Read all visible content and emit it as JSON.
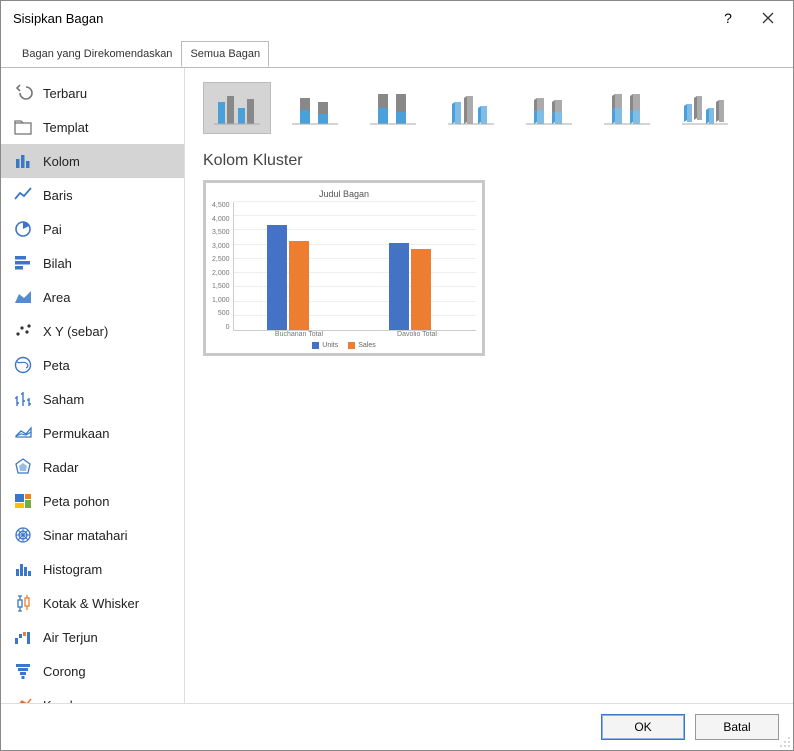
{
  "title": "Sisipkan Bagan",
  "tabs": [
    {
      "label": "Bagan yang Direkomendaskan",
      "active": false
    },
    {
      "label": "Semua Bagan",
      "active": true
    }
  ],
  "sidebar": [
    {
      "icon": "undo",
      "label": "Terbaru"
    },
    {
      "icon": "folder",
      "label": "Templat"
    },
    {
      "icon": "column",
      "label": "Kolom",
      "active": true
    },
    {
      "icon": "line",
      "label": "Baris"
    },
    {
      "icon": "pie",
      "label": "Pai"
    },
    {
      "icon": "bar",
      "label": "Bilah"
    },
    {
      "icon": "area",
      "label": "Area"
    },
    {
      "icon": "scatter",
      "label": "X Y (sebar)"
    },
    {
      "icon": "map",
      "label": "Peta"
    },
    {
      "icon": "stock",
      "label": "Saham"
    },
    {
      "icon": "surface",
      "label": "Permukaan"
    },
    {
      "icon": "radar",
      "label": "Radar"
    },
    {
      "icon": "treemap",
      "label": "Peta pohon"
    },
    {
      "icon": "sunburst",
      "label": "Sinar matahari"
    },
    {
      "icon": "histo",
      "label": "Histogram"
    },
    {
      "icon": "boxw",
      "label": "Kotak & Whisker"
    },
    {
      "icon": "waterfall",
      "label": "Air Terjun"
    },
    {
      "icon": "funnel",
      "label": "Corong"
    },
    {
      "icon": "combo",
      "label": "Kombo"
    }
  ],
  "subtypes": [
    {
      "id": "clustered-column",
      "active": true
    },
    {
      "id": "stacked-column"
    },
    {
      "id": "100-stacked-column"
    },
    {
      "id": "3d-clustered-column"
    },
    {
      "id": "3d-stacked-column"
    },
    {
      "id": "3d-100-stacked-column"
    },
    {
      "id": "3d-column"
    }
  ],
  "chart_name": "Kolom Kluster",
  "chart_data": {
    "type": "bar",
    "title": "Judul Bagan",
    "categories": [
      "Buchanan Total",
      "Davolio Total"
    ],
    "series": [
      {
        "name": "Units",
        "color": "#4472c4",
        "values": [
          4000,
          3300
        ]
      },
      {
        "name": "Sales",
        "color": "#ed7d31",
        "values": [
          3400,
          3100
        ]
      }
    ],
    "ylim": [
      0,
      4500
    ],
    "yticks": [
      0,
      500,
      1000,
      1500,
      2000,
      2500,
      3000,
      3500,
      4000,
      4500
    ]
  },
  "buttons": {
    "ok": "OK",
    "cancel": "Batal"
  }
}
